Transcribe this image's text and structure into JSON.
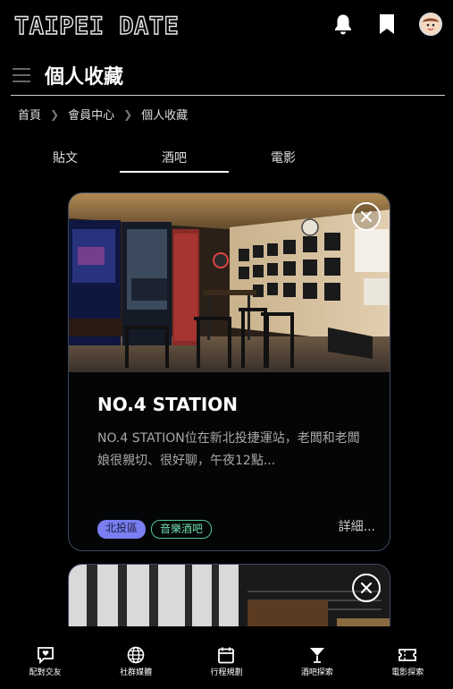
{
  "app": {
    "logo": "TAIPEI DATE"
  },
  "header": {
    "icons": [
      "bell-icon",
      "bookmark-icon",
      "avatar"
    ]
  },
  "page": {
    "title": "個人收藏"
  },
  "breadcrumb": [
    "首頁",
    "會員中心",
    "個人收藏"
  ],
  "tabs": [
    {
      "label": "貼文",
      "active": false
    },
    {
      "label": "酒吧",
      "active": true
    },
    {
      "label": "電影",
      "active": false
    }
  ],
  "cards": [
    {
      "title": "NO.4 STATION",
      "description": "NO.4 STATION位在新北投捷運站，老闆和老闆娘很親切、很好聊，午夜12點...",
      "tags": [
        "北投區",
        "音樂酒吧"
      ],
      "more": "詳細..."
    }
  ],
  "bottom_nav": [
    {
      "label": "配對交友",
      "icon": "chat-heart-icon"
    },
    {
      "label": "社群媒體",
      "icon": "globe-icon"
    },
    {
      "label": "行程規劃",
      "icon": "calendar-icon"
    },
    {
      "label": "酒吧探索",
      "icon": "cocktail-icon"
    },
    {
      "label": "電影探索",
      "icon": "ticket-icon"
    }
  ],
  "colors": {
    "accent_tag": "#7a7ef0",
    "green_tag": "#4fc795",
    "card_border": "#3d4860"
  }
}
